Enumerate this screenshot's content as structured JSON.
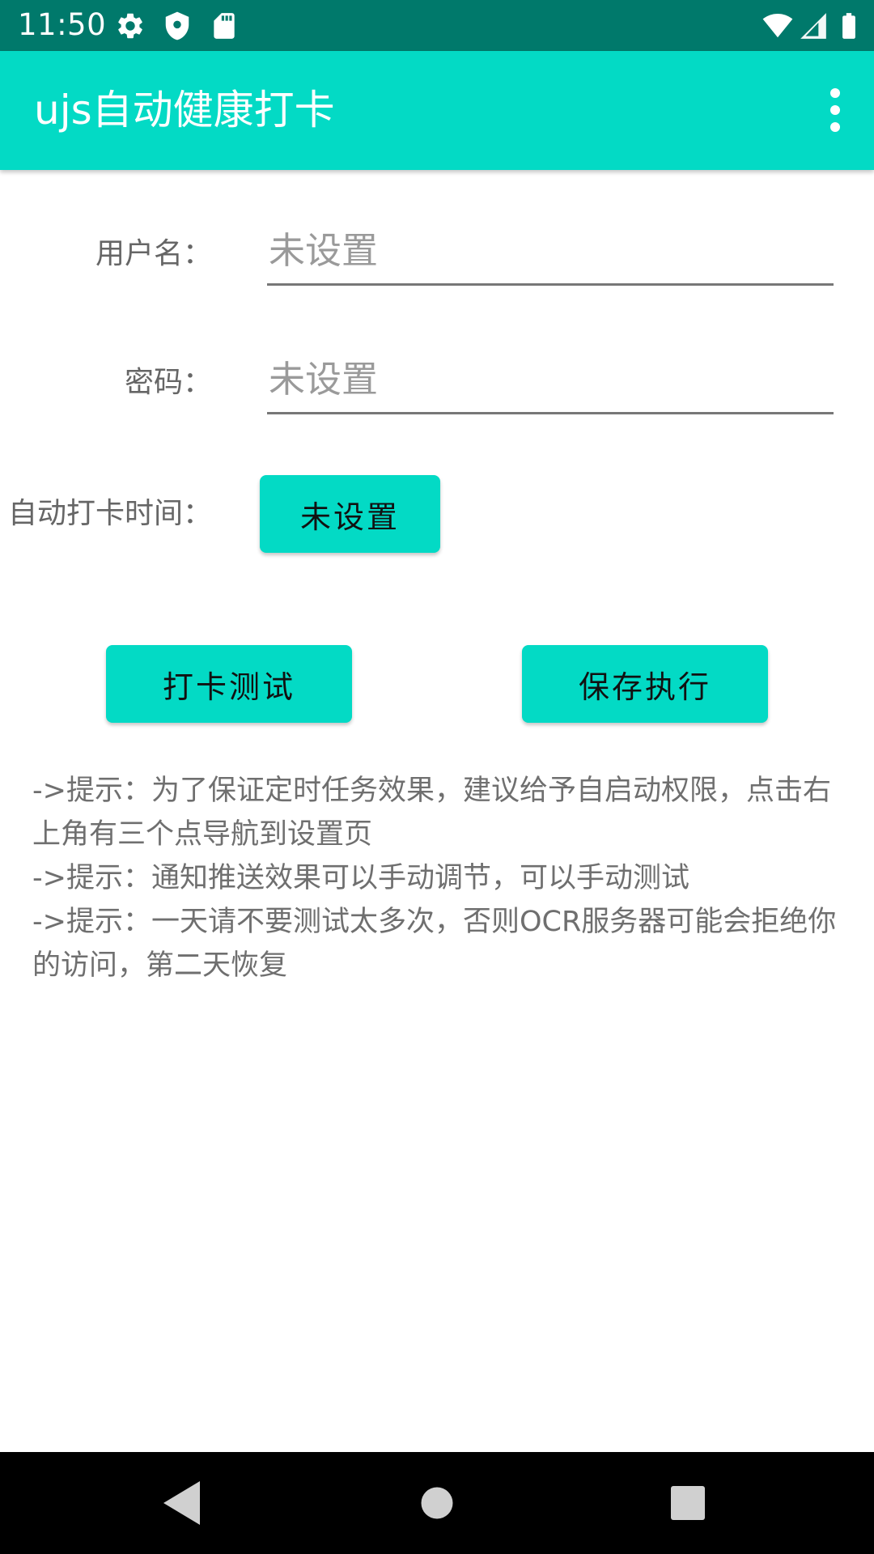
{
  "status_bar": {
    "time": "11:50",
    "left_icons": [
      "gear-icon",
      "shield-icon",
      "sd-card-icon"
    ],
    "right_icons": [
      "wifi-icon",
      "signal-icon",
      "battery-icon"
    ]
  },
  "app_bar": {
    "title": "ujs自动健康打卡",
    "overflow_icon": "more-vert-icon"
  },
  "form": {
    "username": {
      "label": "用户名：",
      "value": "",
      "placeholder": "未设置"
    },
    "password": {
      "label": "密码：",
      "value": "",
      "placeholder": "未设置"
    },
    "auto_time": {
      "label": "自动打卡时间：",
      "button_label": "未设置"
    }
  },
  "actions": {
    "test_label": "打卡测试",
    "save_label": "保存执行"
  },
  "tips": {
    "line1": "->提示：为了保证定时任务效果，建议给予自启动权限，点击右上角有三个点导航到设置页",
    "line2": "->提示：通知推送效果可以手动调节，可以手动测试",
    "line3": "->提示：一天请不要测试太多次，否则OCR服务器可能会拒绝你的访问，第二天恢复"
  },
  "nav_bar": {
    "icons": [
      "back-icon",
      "home-icon",
      "recents-icon"
    ]
  },
  "colors": {
    "status_bar": "#00796b",
    "accent": "#03dac5",
    "hint_text": "#9a9a9a",
    "tip_text": "#6f6f6f"
  }
}
